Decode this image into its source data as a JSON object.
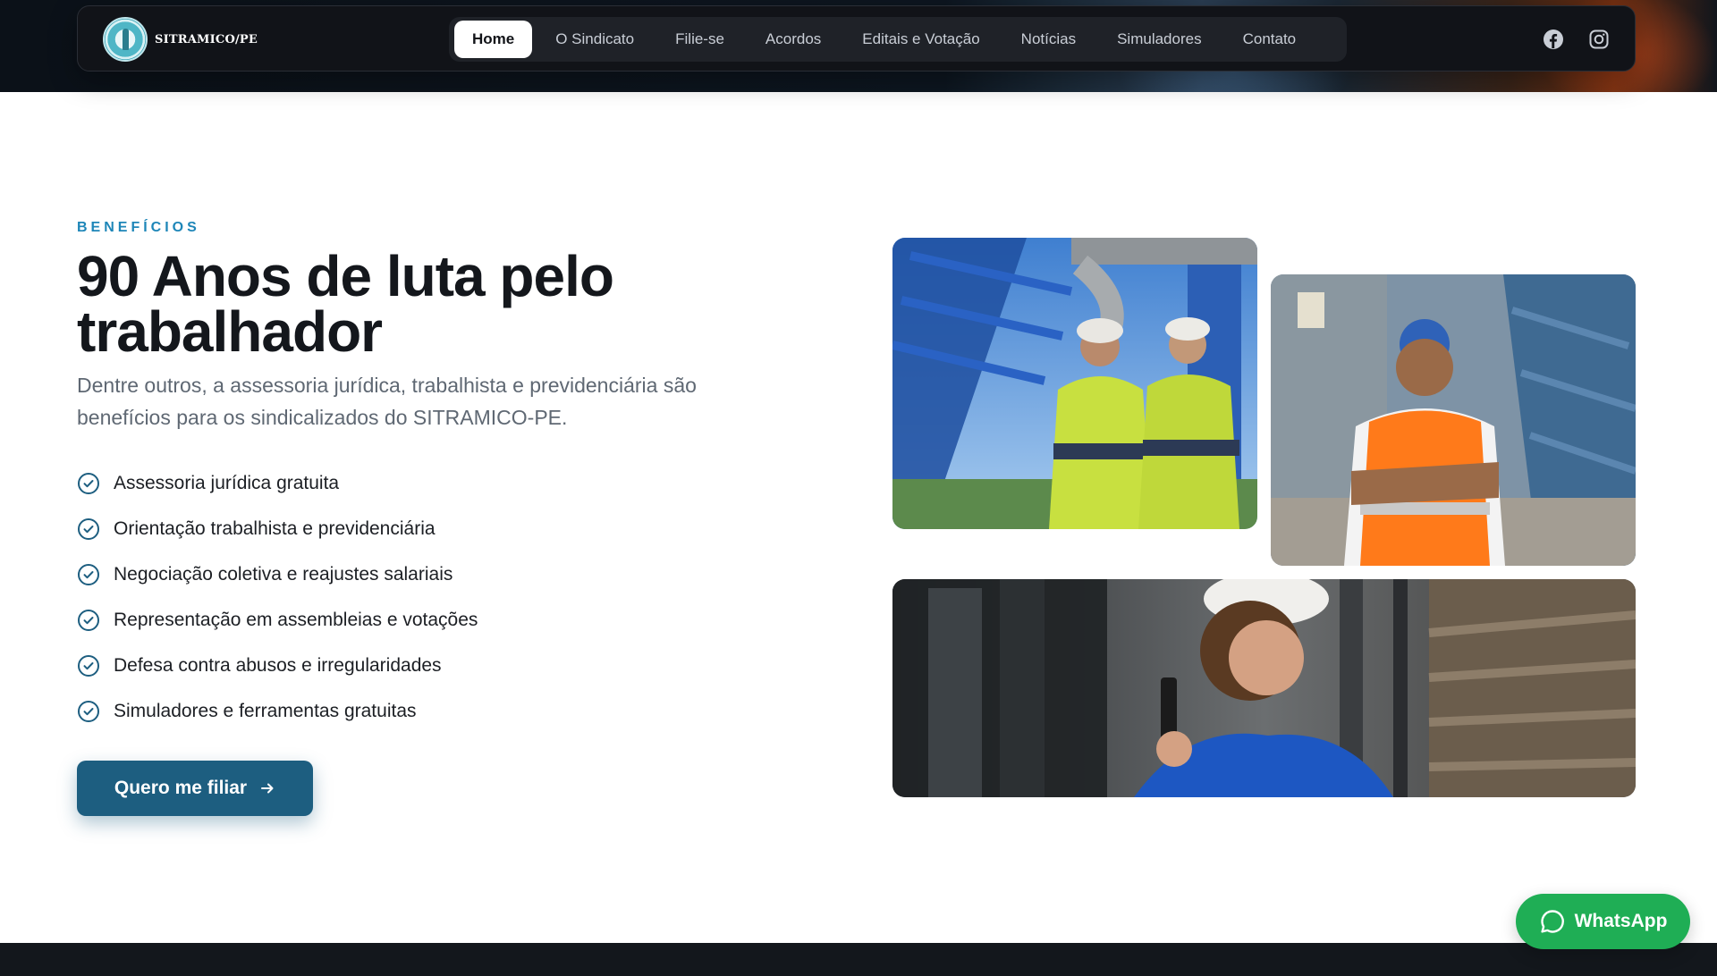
{
  "header": {
    "brand_name": "SITRAMICO/PE",
    "logo_icon": "union-seal-logo",
    "nav": [
      {
        "label": "Home",
        "active": true
      },
      {
        "label": "O Sindicato"
      },
      {
        "label": "Filie-se"
      },
      {
        "label": "Acordos"
      },
      {
        "label": "Editais e Votação"
      },
      {
        "label": "Notícias"
      },
      {
        "label": "Simuladores"
      },
      {
        "label": "Contato"
      }
    ],
    "social_icons": [
      "facebook-icon",
      "instagram-icon"
    ]
  },
  "benefits_section": {
    "eyebrow": "BENEFÍCIOS",
    "title": "90 Anos de luta pelo trabalhador",
    "description": "Dentre outros, a assessoria jurídica, trabalhista e previdenciária são benefícios para os sindicalizados do SITRAMICO-PE.",
    "items": [
      "Assessoria jurídica gratuita",
      "Orientação trabalhista e previdenciária",
      "Negociação coletiva e reajustes salariais",
      "Representação em assembleias e votações",
      "Defesa contra abusos e irregularidades",
      "Simuladores e ferramentas gratuitas"
    ],
    "cta_label": "Quero me filiar"
  },
  "whatsapp": {
    "label": "WhatsApp"
  },
  "colors": {
    "accent": "#1d5e80",
    "eyebrow": "#1e86b8",
    "whatsapp": "#1fae55",
    "dark": "#111318"
  }
}
